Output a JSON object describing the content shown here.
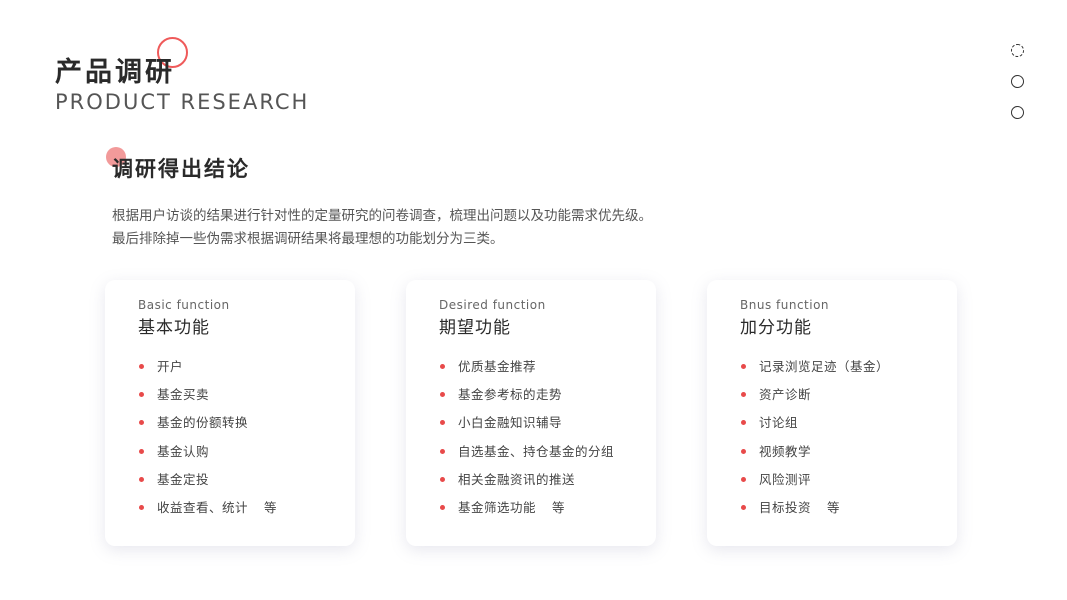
{
  "header": {
    "title_cn": "产品调研",
    "title_en": "PRODUCT RESEARCH"
  },
  "section": {
    "title": "调研得出结论",
    "description": [
      "根据用户访谈的结果进行针对性的定量研究的问卷调查，梳理出问题以及功能需求优先级。",
      "最后排除掉一些伪需求根据调研结果将最理想的功能划分为三类。"
    ]
  },
  "cards": [
    {
      "subtitle": "Basic function",
      "title": "基本功能",
      "items": [
        "开户",
        "基金买卖",
        "基金的份额转换",
        "基金认购",
        "基金定投",
        "收益查看、统计"
      ],
      "suffix": "等"
    },
    {
      "subtitle": "Desired function",
      "title": "期望功能",
      "items": [
        "优质基金推荐",
        "基金参考标的走势",
        "小白金融知识辅导",
        "自选基金、持仓基金的分组",
        "相关金融资讯的推送",
        "基金筛选功能"
      ],
      "suffix": "等"
    },
    {
      "subtitle": "Bnus function",
      "title": "加分功能",
      "items": [
        "记录浏览足迹（基金）",
        "资产诊断",
        "讨论组",
        "视频教学",
        "风险测评",
        "目标投资"
      ],
      "suffix": "等"
    }
  ],
  "colors": {
    "accent": "#ef5a5a",
    "accent_light": "#f29a9a",
    "bullet": "#e84a4a"
  },
  "icons": {
    "title_decoration": "ring-icon",
    "section_marker": "dot-icon",
    "pager": [
      "pager-dot-active-icon",
      "pager-dot-icon",
      "pager-dot-icon"
    ]
  }
}
